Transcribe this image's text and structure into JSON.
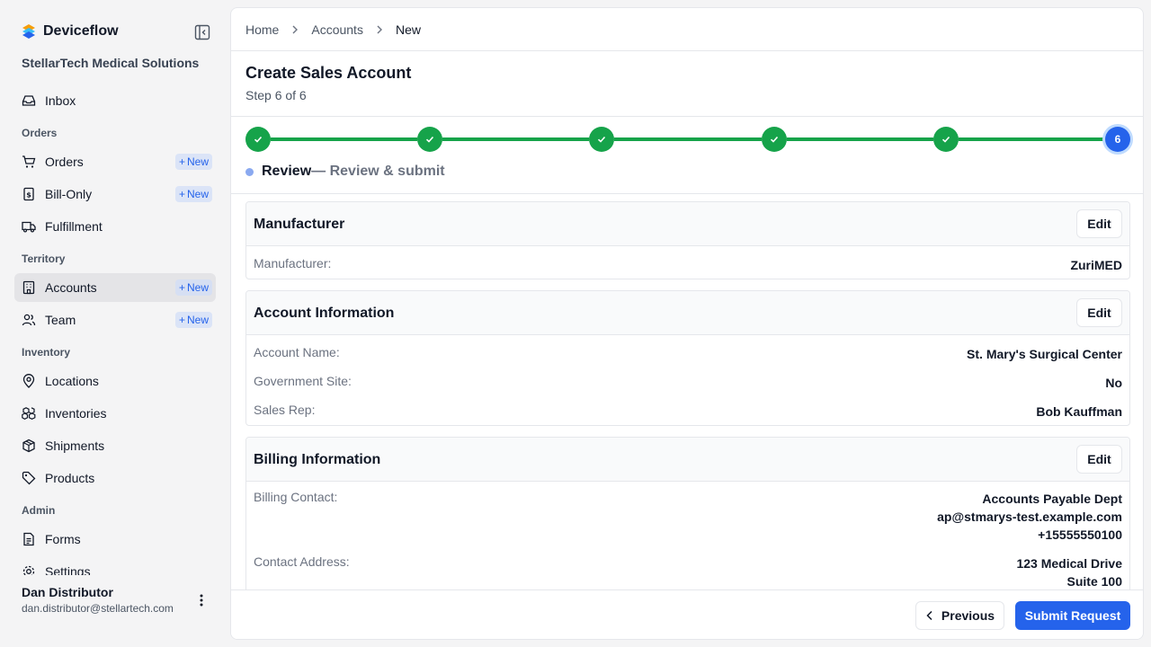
{
  "app": {
    "name": "Deviceflow",
    "org": "StellarTech Medical Solutions"
  },
  "colors": {
    "accent": "#2563eb",
    "success": "#16a34a",
    "badge_bg": "#dbe4f7"
  },
  "sidebar": {
    "items": [
      {
        "label": "Inbox",
        "icon": "inbox-icon"
      },
      {
        "label": "Orders",
        "icon": "cart-icon",
        "badge": "New"
      },
      {
        "label": "Bill-Only",
        "icon": "invoice-icon",
        "badge": "New"
      },
      {
        "label": "Fulfillment",
        "icon": "truck-icon"
      },
      {
        "label": "Accounts",
        "icon": "building-icon",
        "badge": "New",
        "active": true
      },
      {
        "label": "Team",
        "icon": "users-icon",
        "badge": "New"
      },
      {
        "label": "Locations",
        "icon": "map-pin-icon"
      },
      {
        "label": "Inventories",
        "icon": "boxes-icon"
      },
      {
        "label": "Shipments",
        "icon": "package-icon"
      },
      {
        "label": "Products",
        "icon": "tag-icon"
      },
      {
        "label": "Forms",
        "icon": "document-icon"
      },
      {
        "label": "Settings",
        "icon": "gear-icon"
      }
    ],
    "sections": {
      "orders": "Orders",
      "territory": "Territory",
      "inventory": "Inventory",
      "admin": "Admin"
    },
    "user": {
      "name": "Dan Distributor",
      "email": "dan.distributor@stellartech.com"
    }
  },
  "breadcrumb": [
    "Home",
    "Accounts",
    "New"
  ],
  "page": {
    "title": "Create Sales Account",
    "step_text": "Step 6 of 6"
  },
  "stepper": {
    "total": 6,
    "current": 6,
    "current_label": "6",
    "current_name": "Review",
    "current_desc": "— Review & submit"
  },
  "sections": {
    "manufacturer": {
      "title": "Manufacturer",
      "edit": "Edit",
      "rows": [
        {
          "label": "Manufacturer:",
          "value": "ZuriMED"
        }
      ]
    },
    "account": {
      "title": "Account Information",
      "edit": "Edit",
      "rows": [
        {
          "label": "Account Name:",
          "value": "St. Mary's Surgical Center"
        },
        {
          "label": "Government Site:",
          "value": "No"
        },
        {
          "label": "Sales Rep:",
          "value": "Bob Kauffman"
        }
      ]
    },
    "billing": {
      "title": "Billing Information",
      "edit": "Edit",
      "contact_label": "Billing Contact:",
      "contact_lines": [
        "Accounts Payable Dept",
        "ap@stmarys-test.example.com",
        "+15555550100"
      ],
      "address_label": "Contact Address:",
      "address_lines": [
        "123 Medical Drive",
        "Suite 100"
      ]
    }
  },
  "footer": {
    "previous": "Previous",
    "submit": "Submit Request"
  }
}
